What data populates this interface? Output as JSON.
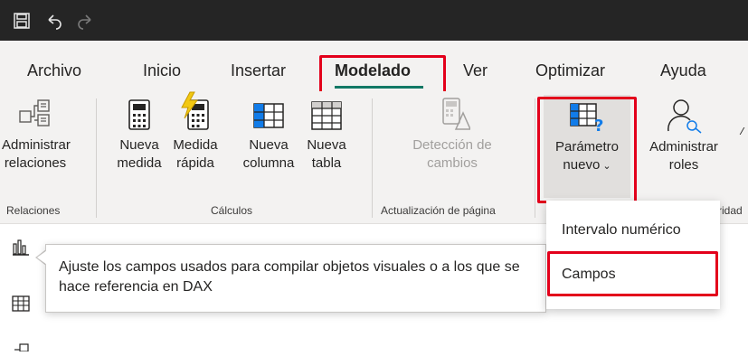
{
  "titlebar": {
    "icons": [
      "save-icon",
      "undo-icon",
      "redo-icon"
    ]
  },
  "menu": {
    "tabs": [
      {
        "label": "Archivo"
      },
      {
        "label": "Inicio"
      },
      {
        "label": "Insertar"
      },
      {
        "label": "Modelado",
        "active": true
      },
      {
        "label": "Ver"
      },
      {
        "label": "Optimizar"
      },
      {
        "label": "Ayuda"
      }
    ],
    "accent_color": "#117865",
    "highlight_color": "#e3001b"
  },
  "ribbon": {
    "administrar_relaciones": {
      "line1": "Administrar",
      "line2": "relaciones"
    },
    "nueva_medida": {
      "line1": "Nueva",
      "line2": "medida"
    },
    "medida_rapida": {
      "line1": "Medida",
      "line2": "rápida"
    },
    "nueva_columna": {
      "line1": "Nueva",
      "line2": "columna"
    },
    "nueva_tabla": {
      "line1": "Nueva",
      "line2": "tabla"
    },
    "deteccion_cambios": {
      "line1": "Detección de",
      "line2": "cambios"
    },
    "parametro_nuevo": {
      "line1": "Parámetro",
      "line2": "nuevo"
    },
    "administrar_roles": {
      "line1": "Administrar",
      "line2": "roles"
    },
    "groups": {
      "relaciones": "Relaciones",
      "calculos": "Cálculos",
      "actualizacion": "Actualización de página",
      "seguridad_partial": "ridad"
    }
  },
  "left_rail": {
    "icons": [
      "report-view-icon",
      "table-view-icon",
      "model-view-icon"
    ]
  },
  "tooltip": {
    "text": "Ajuste los campos usados para compilar objetos visuales o a los que se hace referencia en DAX"
  },
  "dropdown": {
    "items": [
      {
        "label": "Intervalo numérico"
      },
      {
        "label": "Campos",
        "highlighted": true
      }
    ]
  }
}
